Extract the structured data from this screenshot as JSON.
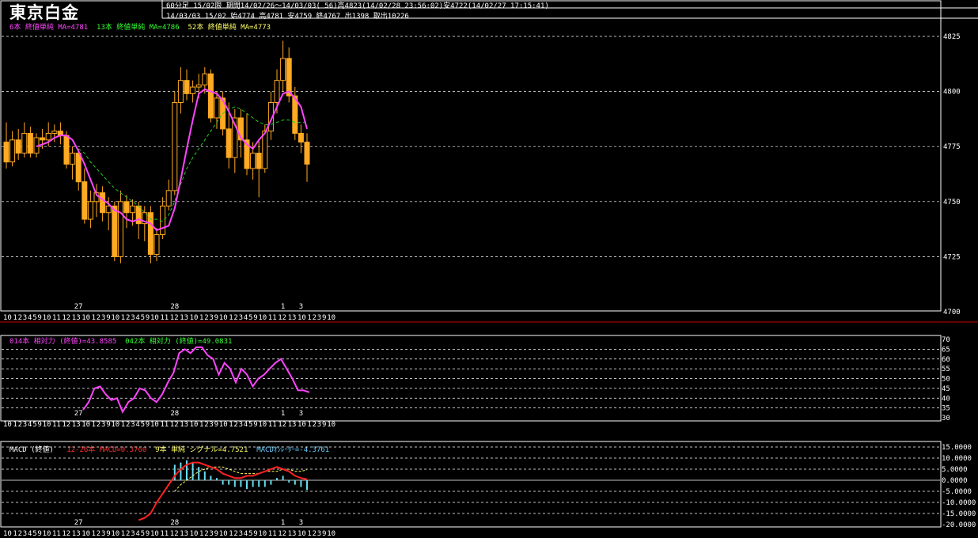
{
  "header": {
    "title": "東京白金",
    "line1": "60分足 15/02限  期間14/02/26〜14/03/03( 56)高4823(14/02/28 23:56:02)安4722(14/02/27 17:15:41)",
    "line2": "14/03/03 15/02 始4774 高4781 安4759 終4767 出1398 取出10226"
  },
  "legends": {
    "main": [
      {
        "text": "6本 終値単純 MA=4781",
        "color": "#ff44ff"
      },
      {
        "text": "13本 終値単純 MA=4786",
        "color": "#33ff33"
      },
      {
        "text": "52本 終値単純 MA=4773",
        "color": "#ffff66"
      }
    ],
    "rsi": [
      {
        "text": "014本 相対力 (終値)=43.8585",
        "color": "#ff44ff"
      },
      {
        "text": "042本 相対力 (終値)=49.0831",
        "color": "#33ff33"
      }
    ],
    "macd": [
      {
        "text": "MACD (終値)",
        "color": "#ffffff"
      },
      {
        "text": "12-26本 MACD=0.3760",
        "color": "#ff3333"
      },
      {
        "text": "9本 単純 シグナル=4.7521",
        "color": "#ffff66"
      },
      {
        "text": "MACDｵｼﾚｰﾀｰ=-4.3761",
        "color": "#66ccff"
      }
    ]
  },
  "colors": {
    "candle": "#ffaa22",
    "ma6": "#ff44ff",
    "ma13": "#22cc22",
    "rsi": "#ff44ff",
    "macd": "#ff2222",
    "signal": "#ffff66",
    "hist": "#66ddee",
    "grid": "#ffffff",
    "separator": "#cc0000"
  },
  "date_labels": [
    {
      "text": "27",
      "index": 12
    },
    {
      "text": "28",
      "index": 28
    },
    {
      "text": "1",
      "index": 46
    },
    {
      "text": "3",
      "index": 49
    }
  ],
  "time_axis_labels": [
    "10",
    "1",
    "2",
    "3",
    "4",
    "5",
    "9",
    "10",
    "11",
    "12",
    "13",
    "10",
    "1",
    "2",
    "3",
    "9",
    "10",
    "1",
    "2",
    "3",
    "4",
    "5",
    "9",
    "10",
    "11",
    "12",
    "13",
    "10",
    "1",
    "2",
    "3",
    "9",
    "10",
    "1",
    "2",
    "3",
    "4",
    "5",
    "9",
    "10",
    "11",
    "12",
    "13",
    "10",
    "1",
    "2",
    "3",
    "9",
    "10"
  ],
  "chart_data": [
    {
      "type": "candlestick",
      "ylim": [
        4700,
        4830
      ],
      "yticks": [
        "4825",
        "4800",
        "4775",
        "4750",
        "4725",
        "4700"
      ],
      "candles": [
        {
          "o": 4777,
          "h": 4786,
          "l": 4765,
          "c": 4768
        },
        {
          "o": 4768,
          "h": 4782,
          "l": 4766,
          "c": 4778
        },
        {
          "o": 4778,
          "h": 4783,
          "l": 4769,
          "c": 4772
        },
        {
          "o": 4772,
          "h": 4786,
          "l": 4770,
          "c": 4781
        },
        {
          "o": 4781,
          "h": 4784,
          "l": 4770,
          "c": 4772
        },
        {
          "o": 4772,
          "h": 4781,
          "l": 4770,
          "c": 4779
        },
        {
          "o": 4779,
          "h": 4783,
          "l": 4774,
          "c": 4778
        },
        {
          "o": 4778,
          "h": 4786,
          "l": 4775,
          "c": 4781
        },
        {
          "o": 4781,
          "h": 4785,
          "l": 4777,
          "c": 4782
        },
        {
          "o": 4782,
          "h": 4786,
          "l": 4776,
          "c": 4780
        },
        {
          "o": 4780,
          "h": 4782,
          "l": 4765,
          "c": 4767
        },
        {
          "o": 4767,
          "h": 4775,
          "l": 4760,
          "c": 4772
        },
        {
          "o": 4772,
          "h": 4774,
          "l": 4755,
          "c": 4759
        },
        {
          "o": 4759,
          "h": 4765,
          "l": 4740,
          "c": 4742
        },
        {
          "o": 4742,
          "h": 4755,
          "l": 4738,
          "c": 4750
        },
        {
          "o": 4750,
          "h": 4758,
          "l": 4743,
          "c": 4754
        },
        {
          "o": 4754,
          "h": 4757,
          "l": 4741,
          "c": 4745
        },
        {
          "o": 4745,
          "h": 4752,
          "l": 4737,
          "c": 4748
        },
        {
          "o": 4748,
          "h": 4750,
          "l": 4723,
          "c": 4725
        },
        {
          "o": 4725,
          "h": 4755,
          "l": 4722,
          "c": 4750
        },
        {
          "o": 4750,
          "h": 4753,
          "l": 4738,
          "c": 4745
        },
        {
          "o": 4745,
          "h": 4751,
          "l": 4739,
          "c": 4748
        },
        {
          "o": 4748,
          "h": 4750,
          "l": 4733,
          "c": 4740
        },
        {
          "o": 4740,
          "h": 4748,
          "l": 4732,
          "c": 4745
        },
        {
          "o": 4745,
          "h": 4748,
          "l": 4722,
          "c": 4726
        },
        {
          "o": 4726,
          "h": 4738,
          "l": 4723,
          "c": 4735
        },
        {
          "o": 4735,
          "h": 4752,
          "l": 4733,
          "c": 4748
        },
        {
          "o": 4748,
          "h": 4760,
          "l": 4746,
          "c": 4755
        },
        {
          "o": 4755,
          "h": 4800,
          "l": 4753,
          "c": 4795
        },
        {
          "o": 4795,
          "h": 4811,
          "l": 4790,
          "c": 4805
        },
        {
          "o": 4805,
          "h": 4810,
          "l": 4796,
          "c": 4799
        },
        {
          "o": 4799,
          "h": 4805,
          "l": 4795,
          "c": 4802
        },
        {
          "o": 4802,
          "h": 4808,
          "l": 4797,
          "c": 4803
        },
        {
          "o": 4803,
          "h": 4811,
          "l": 4799,
          "c": 4808
        },
        {
          "o": 4808,
          "h": 4810,
          "l": 4786,
          "c": 4788
        },
        {
          "o": 4788,
          "h": 4800,
          "l": 4783,
          "c": 4797
        },
        {
          "o": 4797,
          "h": 4800,
          "l": 4780,
          "c": 4783
        },
        {
          "o": 4783,
          "h": 4795,
          "l": 4765,
          "c": 4770
        },
        {
          "o": 4770,
          "h": 4792,
          "l": 4763,
          "c": 4788
        },
        {
          "o": 4788,
          "h": 4792,
          "l": 4770,
          "c": 4778
        },
        {
          "o": 4778,
          "h": 4790,
          "l": 4762,
          "c": 4765
        },
        {
          "o": 4765,
          "h": 4777,
          "l": 4760,
          "c": 4772
        },
        {
          "o": 4772,
          "h": 4778,
          "l": 4752,
          "c": 4765
        },
        {
          "o": 4765,
          "h": 4785,
          "l": 4763,
          "c": 4782
        },
        {
          "o": 4782,
          "h": 4800,
          "l": 4778,
          "c": 4795
        },
        {
          "o": 4795,
          "h": 4810,
          "l": 4790,
          "c": 4805
        },
        {
          "o": 4805,
          "h": 4823,
          "l": 4800,
          "c": 4815
        },
        {
          "o": 4815,
          "h": 4820,
          "l": 4795,
          "c": 4798
        },
        {
          "o": 4798,
          "h": 4802,
          "l": 4778,
          "c": 4781
        },
        {
          "o": 4781,
          "h": 4785,
          "l": 4772,
          "c": 4777
        },
        {
          "o": 4777,
          "h": 4781,
          "l": 4759,
          "c": 4767
        }
      ],
      "ma6": [
        null,
        null,
        null,
        null,
        null,
        4775,
        4776,
        4777,
        4779,
        4780,
        4780,
        4778,
        4773,
        4767,
        4760,
        4753,
        4751,
        4749,
        4746,
        4745,
        4742,
        4741,
        4742,
        4741,
        4740,
        4737,
        4738,
        4739,
        4747,
        4760,
        4774,
        4787,
        4799,
        4801,
        4800,
        4799,
        4796,
        4791,
        4785,
        4779,
        4776,
        4774,
        4778,
        4781,
        4787,
        4793,
        4799,
        4800,
        4797,
        4793,
        4783
      ],
      "ma13": [
        null,
        null,
        null,
        null,
        null,
        null,
        null,
        null,
        null,
        null,
        null,
        null,
        4774,
        4772,
        4768,
        4765,
        4762,
        4759,
        4756,
        4754,
        4752,
        4750,
        4748,
        4745,
        4742,
        4742,
        4741,
        4744,
        4750,
        4758,
        4765,
        4770,
        4774,
        4778,
        4782,
        4786,
        4790,
        4792,
        4793,
        4792,
        4790,
        4788,
        4786,
        4785,
        4785,
        4786,
        4787,
        4787,
        4786,
        4786,
        4786
      ]
    },
    {
      "type": "line",
      "name": "RSI",
      "ylim": [
        30,
        70
      ],
      "yticks": [
        "70",
        "65",
        "60",
        "55",
        "50",
        "45",
        "40",
        "35",
        "30"
      ],
      "values": [
        null,
        null,
        null,
        null,
        null,
        null,
        null,
        null,
        null,
        null,
        null,
        null,
        null,
        34,
        38,
        45,
        46,
        42,
        39,
        40,
        33,
        38,
        40,
        45,
        44,
        40,
        38,
        42,
        48,
        53,
        63,
        65,
        63,
        66,
        66,
        62,
        60,
        52,
        58,
        55,
        48,
        55,
        52,
        46,
        50,
        52,
        55,
        58,
        60,
        55,
        50,
        44,
        44,
        43
      ]
    },
    {
      "type": "line",
      "name": "MACD",
      "ylim": [
        -20,
        15
      ],
      "yticks": [
        "15.0000",
        "10.0000",
        "5.0000",
        "0.0000",
        "-5.0000",
        "-10.0000",
        "-15.0000",
        "-20.0000"
      ],
      "macd": [
        null,
        null,
        null,
        null,
        null,
        null,
        null,
        null,
        null,
        null,
        null,
        null,
        null,
        null,
        null,
        null,
        null,
        null,
        null,
        null,
        null,
        null,
        -18,
        -17,
        -15,
        -10,
        -6,
        -2,
        2,
        5,
        7,
        8,
        8,
        7,
        6,
        5,
        3,
        2,
        1,
        1,
        2,
        2,
        3,
        4,
        5,
        6,
        5,
        4,
        2,
        1,
        0.4
      ],
      "signal": [
        null,
        null,
        null,
        null,
        null,
        null,
        null,
        null,
        null,
        null,
        null,
        null,
        null,
        null,
        null,
        null,
        null,
        null,
        null,
        null,
        null,
        null,
        null,
        null,
        null,
        null,
        null,
        null,
        -5,
        -2,
        0,
        2,
        4,
        5,
        6,
        6,
        6,
        5,
        4,
        3,
        3,
        3,
        3,
        4,
        4,
        4,
        5,
        5,
        4,
        4,
        4.75
      ],
      "hist": [
        null,
        null,
        null,
        null,
        null,
        null,
        null,
        null,
        null,
        null,
        null,
        null,
        null,
        null,
        null,
        null,
        null,
        null,
        null,
        null,
        null,
        null,
        null,
        null,
        null,
        null,
        null,
        null,
        7,
        8,
        9,
        8,
        6,
        4,
        2,
        1,
        -2,
        -2,
        -3,
        -3,
        -4,
        -3,
        -3,
        -3,
        -2,
        1,
        2,
        -1,
        -2,
        -3,
        -4.4
      ]
    }
  ]
}
